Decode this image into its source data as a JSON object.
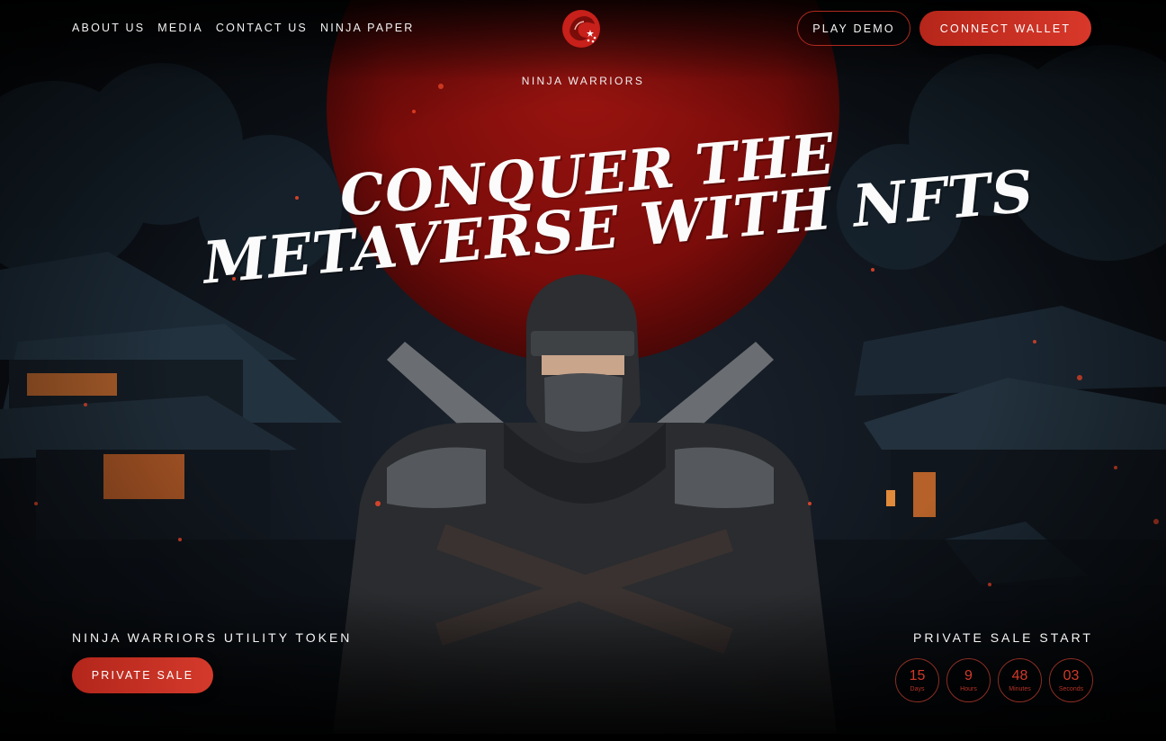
{
  "nav": {
    "links": [
      "ABOUT US",
      "MEDIA",
      "CONTACT US",
      "NINJA PAPER"
    ],
    "play_demo": "PLAY DEMO",
    "connect_wallet": "CONNECT WALLET"
  },
  "brand": {
    "name": "NINJA WARRIORS",
    "logo_icon": "red-dragon-logo-icon"
  },
  "hero": {
    "line1": "CONQUER THE",
    "line2": "METAVERSE WITH NFTS"
  },
  "token": {
    "title": "NINJA WARRIORS UTILITY TOKEN",
    "button": "PRIVATE SALE"
  },
  "sale": {
    "title": "PRIVATE SALE START",
    "countdown": [
      {
        "value": "15",
        "label": "Days"
      },
      {
        "value": "9",
        "label": "Hours"
      },
      {
        "value": "48",
        "label": "Minutes"
      },
      {
        "value": "03",
        "label": "Seconds"
      }
    ]
  },
  "colors": {
    "accent": "#d4382a",
    "background": "#0a0d12",
    "moon": "#8c0f0c"
  }
}
